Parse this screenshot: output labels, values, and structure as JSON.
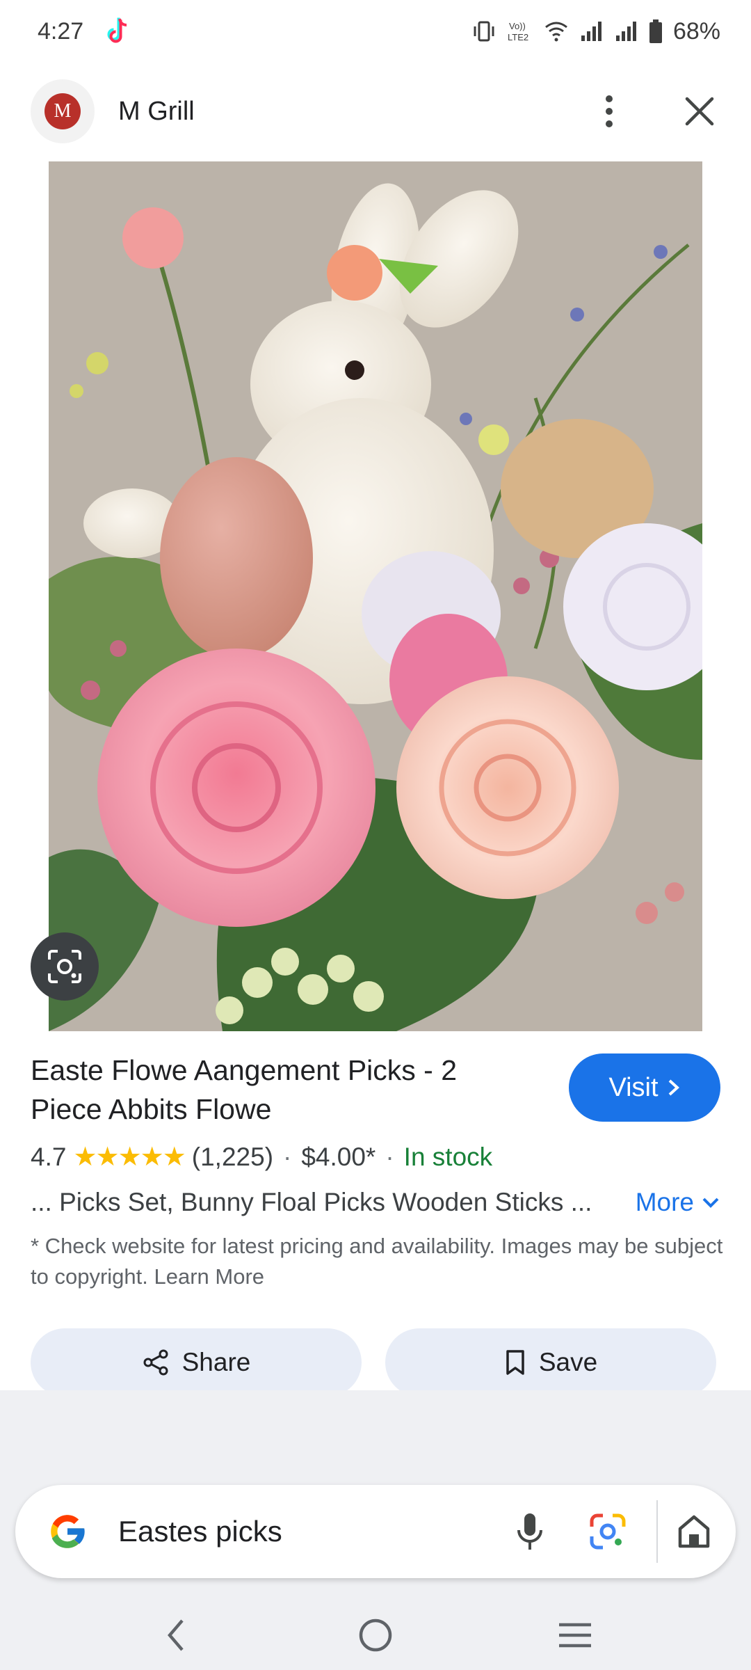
{
  "status": {
    "time": "4:27",
    "battery": "68%"
  },
  "header": {
    "site_name": "M Grill",
    "logo_letter": "M"
  },
  "product": {
    "title": "Easte Flowe Aangement Picks - 2 Piece Abbits Flowe",
    "visit_label": "Visit",
    "rating": "4.7",
    "stars": "★★★★★",
    "reviews": "(1,225)",
    "price": "$4.00*",
    "availability": "In stock",
    "snippet": "... Picks Set, Bunny Floal Picks Wooden Sticks ...",
    "more_label": "More",
    "disclaimer": "* Check website for latest pricing and availability. Images may be subject to copyright. Learn More"
  },
  "actions": {
    "share_label": "Share",
    "save_label": "Save"
  },
  "search": {
    "query": "Eastes picks"
  },
  "colors": {
    "accent": "#1a73e8",
    "in_stock": "#188038",
    "star": "#fbbc04",
    "action_bg": "#e8edf7"
  },
  "icons": [
    "tiktok-icon",
    "vibrate-icon",
    "volte-icon",
    "wifi-icon",
    "signal-icon",
    "battery-icon",
    "more-vert-icon",
    "close-icon",
    "lens-icon",
    "chevron-right-icon",
    "chevron-down-icon",
    "share-icon",
    "bookmark-icon",
    "google-logo-icon",
    "mic-icon",
    "google-lens-icon",
    "home-icon",
    "back-icon",
    "home-circle-icon",
    "recents-icon"
  ]
}
